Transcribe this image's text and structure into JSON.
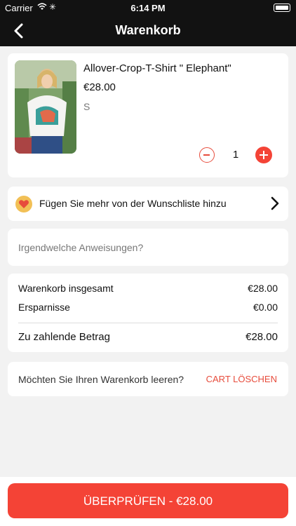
{
  "status_bar": {
    "carrier": "Carrier",
    "time": "6:14 PM"
  },
  "nav": {
    "title": "Warenkorb"
  },
  "product": {
    "name": "Allover-Crop-T-Shirt \" Elephant\"",
    "price": "€28.00",
    "size": "S",
    "quantity": "1"
  },
  "wishlist": {
    "label": "Fügen Sie mehr von der Wunschliste hinzu"
  },
  "instructions": {
    "placeholder": "Irgendwelche Anweisungen?"
  },
  "summary": {
    "rows": [
      {
        "label": "Warenkorb insgesamt",
        "value": "€28.00"
      },
      {
        "label": "Ersparnisse",
        "value": "€0.00"
      }
    ],
    "total": {
      "label": "Zu zahlende Betrag",
      "value": "€28.00"
    }
  },
  "clear_cart": {
    "question": "Möchten Sie Ihren Warenkorb leeren?",
    "button": "CART LÖSCHEN"
  },
  "checkout": {
    "label": "ÜBERPRÜFEN - €28.00"
  },
  "colors": {
    "accent": "#f44336",
    "dark_bar": "#121212",
    "background": "#f2f2f2",
    "wishlist_badge": "#f2c056"
  }
}
